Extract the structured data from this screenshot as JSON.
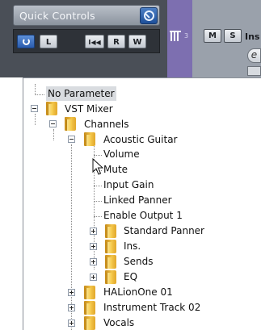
{
  "quick_controls": {
    "title": "Quick Controls",
    "buttons": {
      "power": "",
      "link": "L",
      "rewind": "I◀◀",
      "read": "R",
      "write": "W"
    }
  },
  "track_header": {
    "number": "3",
    "mute_label": "M",
    "solo_label": "S",
    "name_fragment": "Ins",
    "edit_label": "e"
  },
  "popup_tree": {
    "no_parameter": "No Parameter",
    "vst_mixer": "VST Mixer",
    "channels": "Channels",
    "acoustic_guitar": "Acoustic Guitar",
    "params": [
      "Volume",
      "Mute",
      "Input Gain",
      "Linked Panner",
      "Enable Output 1"
    ],
    "subfolders": [
      "Standard Panner",
      "Ins.",
      "Sends",
      "EQ"
    ],
    "other_channels": [
      "HALionOne 01",
      "Instrument Track 02",
      "Vocals"
    ]
  },
  "colors": {
    "header_bg": "#4a4f57",
    "accent_blue": "#2a5cae",
    "purple_track": "#7d6fb0"
  }
}
